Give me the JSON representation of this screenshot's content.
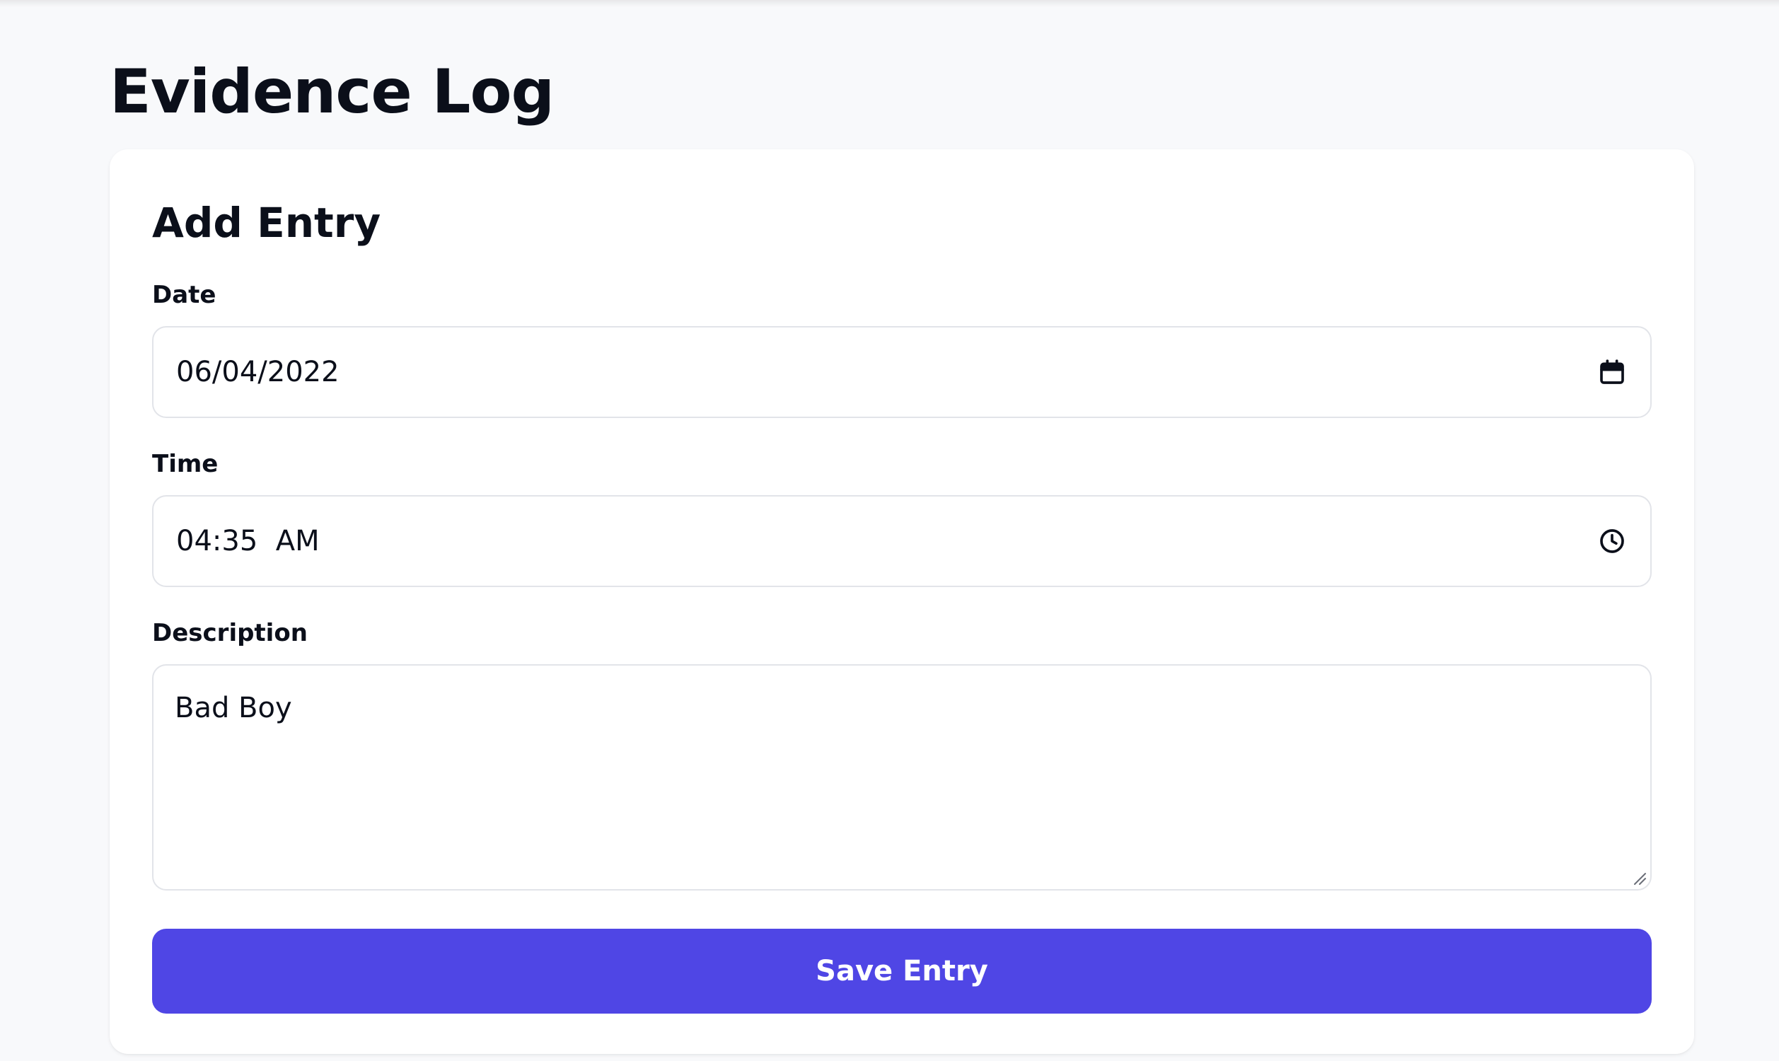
{
  "page": {
    "title": "Evidence Log"
  },
  "form": {
    "title": "Add Entry",
    "date": {
      "label": "Date",
      "value": "06/04/2022",
      "icon": "calendar-icon"
    },
    "time": {
      "label": "Time",
      "value": "04:35  AM",
      "icon": "clock-icon"
    },
    "description": {
      "label": "Description",
      "value": "Bad Boy"
    },
    "submit_label": "Save Entry"
  },
  "colors": {
    "background": "#f8f9fb",
    "card": "#ffffff",
    "accent": "#4f46e5",
    "text": "#0b0f1a",
    "input_border": "#e2e4e9"
  }
}
